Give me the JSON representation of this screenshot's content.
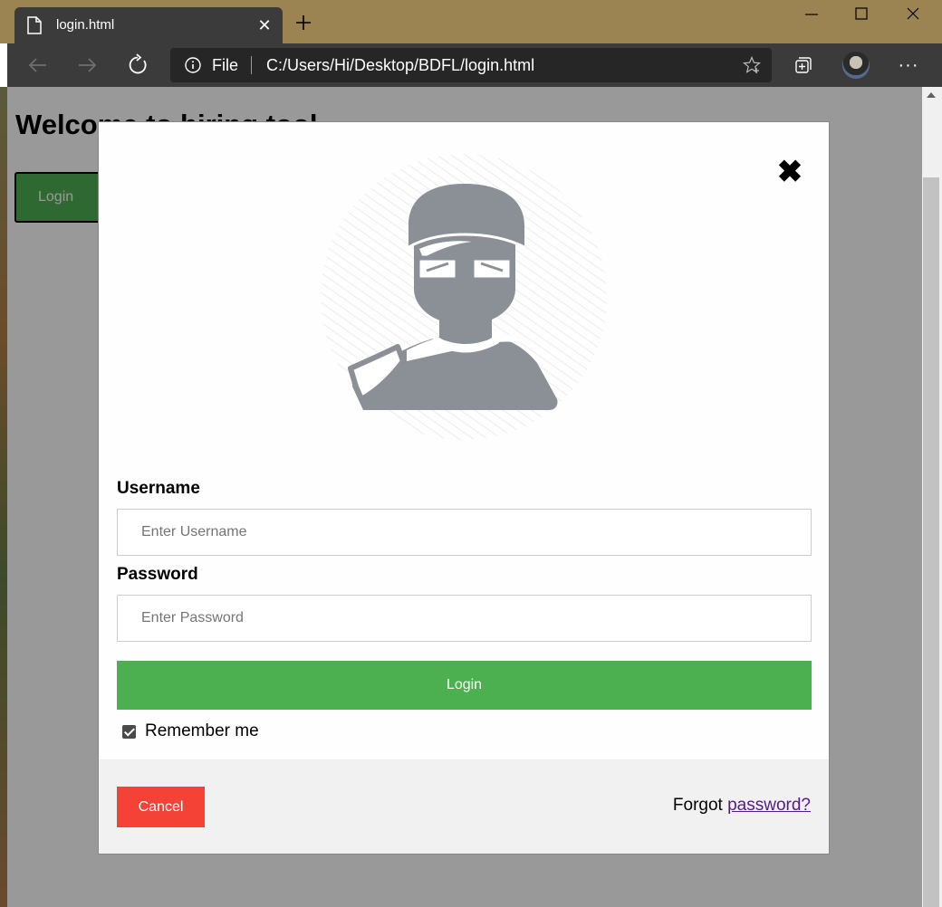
{
  "browser": {
    "tab": {
      "title": "login.html",
      "close_symbol": "✕"
    },
    "address": {
      "scheme": "File",
      "url": "C:/Users/Hi/Desktop/BDFL/login.html"
    },
    "menu_symbol": "···"
  },
  "page": {
    "heading": "Welcome to hiring tool",
    "open_login_label": "Login"
  },
  "modal": {
    "close_symbol": "✖",
    "username": {
      "label": "Username",
      "placeholder": "Enter Username",
      "value": ""
    },
    "password": {
      "label": "Password",
      "placeholder": "Enter Password",
      "value": ""
    },
    "submit_label": "Login",
    "remember": {
      "label": "Remember me",
      "checked": true
    },
    "footer": {
      "cancel_label": "Cancel",
      "forgot_prefix": "Forgot ",
      "forgot_link": "password?"
    }
  },
  "colors": {
    "titlebar": "#9b8452",
    "chrome_dark": "#3b3b3b",
    "accent_green": "#4caf50",
    "cancel_red": "#f44336",
    "link_purple": "#551a8b",
    "avatar_gray": "#8b9097"
  }
}
